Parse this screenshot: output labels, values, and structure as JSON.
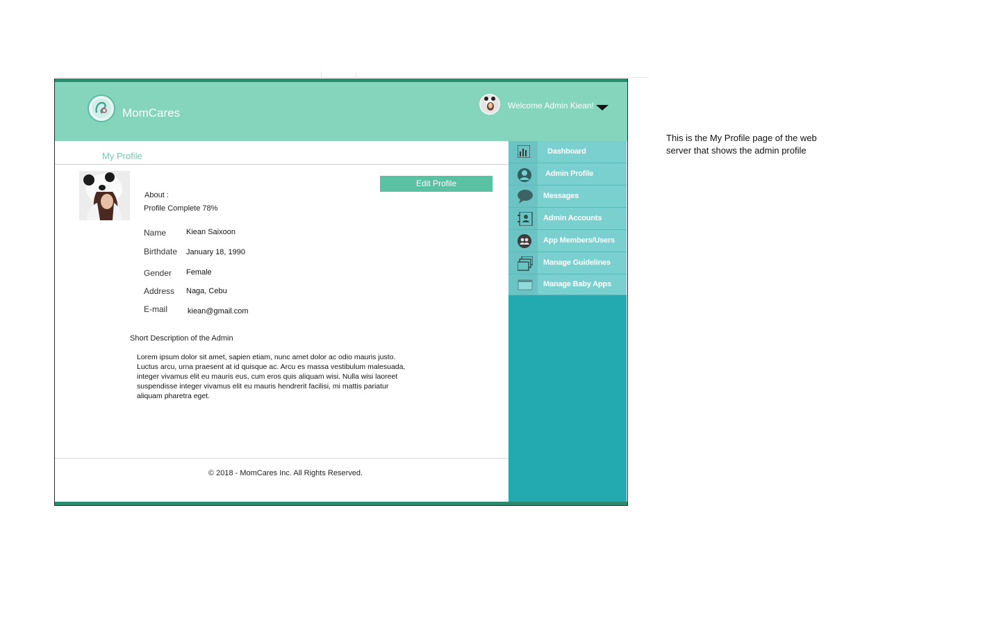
{
  "header": {
    "brand": "MomCares",
    "welcome": "Welcome Admin Kiean!"
  },
  "page": {
    "title": "My Profile",
    "edit_button": "Edit Profile",
    "about_label": "About  :",
    "profile_complete": "Profile Complete 78%",
    "profile_complete_value": 0.78
  },
  "profile": {
    "fields": [
      {
        "label": "Name",
        "value": "Kiean Saixoon"
      },
      {
        "label": "Birthdate",
        "value": "January 18, 1990"
      },
      {
        "label": "Gender",
        "value": "Female"
      },
      {
        "label": "Address",
        "value": "Naga, Cebu"
      },
      {
        "label": "E-mail",
        "value": "kiean@gmail.com"
      }
    ],
    "description_heading": "Short Description of  the Admin",
    "description": "Lorem ipsum dolor sit amet, sapien etiam, nunc amet dolor ac odio mauris justo. Luctus arcu, urna praesent at id quisque ac. Arcu es massa vestibulum malesuada, integer vivamus elit eu mauris eus, cum eros quis aliquam wisi. Nulla wisi laoreet suspendisse integer vivamus elit eu mauris hendrerit facilisi, mi mattis pariatur aliquam pharetra eget."
  },
  "sidebar": {
    "items": [
      {
        "label": "Dashboard",
        "icon": "bar-chart-icon"
      },
      {
        "label": "Admin Profile",
        "icon": "user-icon"
      },
      {
        "label": "Messages",
        "icon": "speech-bubble-icon"
      },
      {
        "label": "Admin Accounts",
        "icon": "contact-card-icon"
      },
      {
        "label": "App Members/Users",
        "icon": "group-icon"
      },
      {
        "label": "Manage Guidelines",
        "icon": "stacked-windows-icon"
      },
      {
        "label": "Manage Baby Apps",
        "icon": "window-icon"
      }
    ]
  },
  "footer": {
    "copyright": "© 2018 - MomCares Inc. All Rights Reserved."
  },
  "note": {
    "text": "This is the My Profile page of the web server that shows the admin profile"
  },
  "colors": {
    "header": "#84d5bb",
    "accent_button": "#5bc1a3",
    "sidebar": "#22aab0",
    "sidebar_item": "#7acfcf",
    "frame_border": "#2c8a6d"
  }
}
